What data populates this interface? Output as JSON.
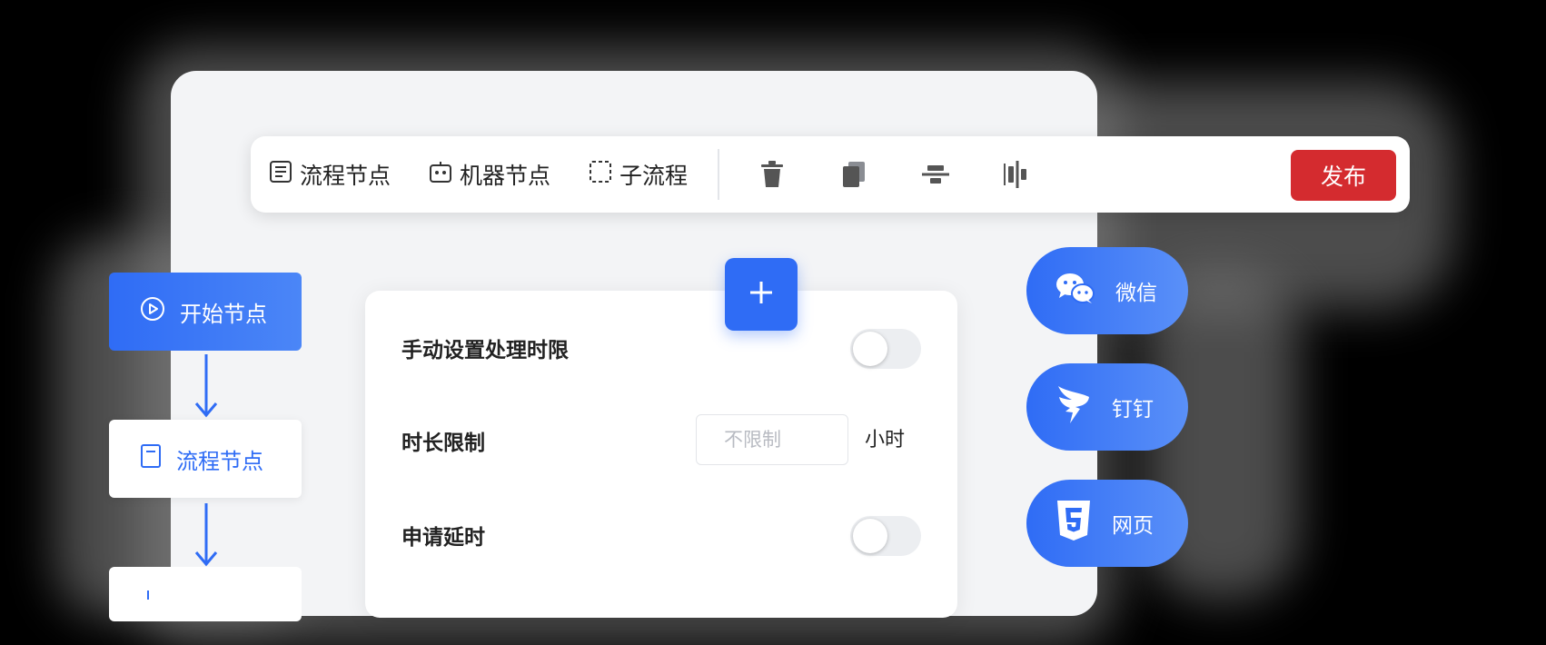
{
  "toolbar": {
    "items": [
      {
        "label": "流程节点",
        "icon": "form-icon"
      },
      {
        "label": "机器节点",
        "icon": "robot-icon"
      },
      {
        "label": "子流程",
        "icon": "dashed-square-icon"
      }
    ],
    "tools": [
      "trash-icon",
      "copy-icon",
      "align-center-icon",
      "align-middle-icon"
    ],
    "publish_label": "发布"
  },
  "flow": {
    "nodes": [
      {
        "label": "开始节点",
        "icon": "play-circle-icon"
      },
      {
        "label": "流程节点",
        "icon": "document-icon"
      }
    ]
  },
  "settings": {
    "manual_limit_label": "手动设置处理时限",
    "manual_limit_on": false,
    "duration_label": "时长限制",
    "duration_placeholder": "不限制",
    "duration_value": "",
    "duration_unit": "小时",
    "extension_label": "申请延时",
    "extension_on": false
  },
  "channels": [
    {
      "label": "微信",
      "icon": "wechat-icon"
    },
    {
      "label": "钉钉",
      "icon": "dingtalk-icon"
    },
    {
      "label": "网页",
      "icon": "html5-icon"
    }
  ],
  "colors": {
    "accent": "#2f6cf5",
    "publish": "#d42b2f",
    "background": "#000000"
  }
}
